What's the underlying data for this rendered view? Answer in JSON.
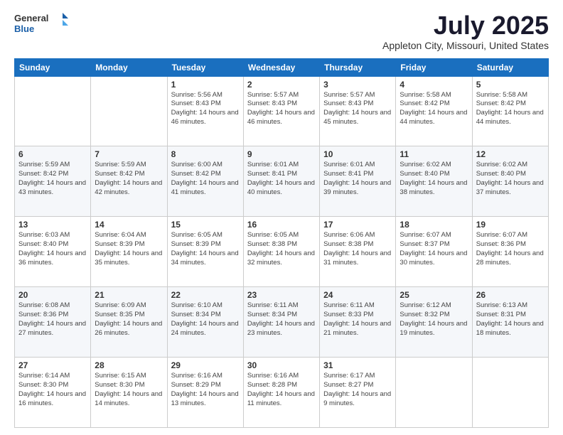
{
  "header": {
    "logo_general": "General",
    "logo_blue": "Blue",
    "month_title": "July 2025",
    "subtitle": "Appleton City, Missouri, United States"
  },
  "weekdays": [
    "Sunday",
    "Monday",
    "Tuesday",
    "Wednesday",
    "Thursday",
    "Friday",
    "Saturday"
  ],
  "weeks": [
    [
      {
        "day": "",
        "info": ""
      },
      {
        "day": "",
        "info": ""
      },
      {
        "day": "1",
        "info": "Sunrise: 5:56 AM\nSunset: 8:43 PM\nDaylight: 14 hours and 46 minutes."
      },
      {
        "day": "2",
        "info": "Sunrise: 5:57 AM\nSunset: 8:43 PM\nDaylight: 14 hours and 46 minutes."
      },
      {
        "day": "3",
        "info": "Sunrise: 5:57 AM\nSunset: 8:43 PM\nDaylight: 14 hours and 45 minutes."
      },
      {
        "day": "4",
        "info": "Sunrise: 5:58 AM\nSunset: 8:42 PM\nDaylight: 14 hours and 44 minutes."
      },
      {
        "day": "5",
        "info": "Sunrise: 5:58 AM\nSunset: 8:42 PM\nDaylight: 14 hours and 44 minutes."
      }
    ],
    [
      {
        "day": "6",
        "info": "Sunrise: 5:59 AM\nSunset: 8:42 PM\nDaylight: 14 hours and 43 minutes."
      },
      {
        "day": "7",
        "info": "Sunrise: 5:59 AM\nSunset: 8:42 PM\nDaylight: 14 hours and 42 minutes."
      },
      {
        "day": "8",
        "info": "Sunrise: 6:00 AM\nSunset: 8:42 PM\nDaylight: 14 hours and 41 minutes."
      },
      {
        "day": "9",
        "info": "Sunrise: 6:01 AM\nSunset: 8:41 PM\nDaylight: 14 hours and 40 minutes."
      },
      {
        "day": "10",
        "info": "Sunrise: 6:01 AM\nSunset: 8:41 PM\nDaylight: 14 hours and 39 minutes."
      },
      {
        "day": "11",
        "info": "Sunrise: 6:02 AM\nSunset: 8:40 PM\nDaylight: 14 hours and 38 minutes."
      },
      {
        "day": "12",
        "info": "Sunrise: 6:02 AM\nSunset: 8:40 PM\nDaylight: 14 hours and 37 minutes."
      }
    ],
    [
      {
        "day": "13",
        "info": "Sunrise: 6:03 AM\nSunset: 8:40 PM\nDaylight: 14 hours and 36 minutes."
      },
      {
        "day": "14",
        "info": "Sunrise: 6:04 AM\nSunset: 8:39 PM\nDaylight: 14 hours and 35 minutes."
      },
      {
        "day": "15",
        "info": "Sunrise: 6:05 AM\nSunset: 8:39 PM\nDaylight: 14 hours and 34 minutes."
      },
      {
        "day": "16",
        "info": "Sunrise: 6:05 AM\nSunset: 8:38 PM\nDaylight: 14 hours and 32 minutes."
      },
      {
        "day": "17",
        "info": "Sunrise: 6:06 AM\nSunset: 8:38 PM\nDaylight: 14 hours and 31 minutes."
      },
      {
        "day": "18",
        "info": "Sunrise: 6:07 AM\nSunset: 8:37 PM\nDaylight: 14 hours and 30 minutes."
      },
      {
        "day": "19",
        "info": "Sunrise: 6:07 AM\nSunset: 8:36 PM\nDaylight: 14 hours and 28 minutes."
      }
    ],
    [
      {
        "day": "20",
        "info": "Sunrise: 6:08 AM\nSunset: 8:36 PM\nDaylight: 14 hours and 27 minutes."
      },
      {
        "day": "21",
        "info": "Sunrise: 6:09 AM\nSunset: 8:35 PM\nDaylight: 14 hours and 26 minutes."
      },
      {
        "day": "22",
        "info": "Sunrise: 6:10 AM\nSunset: 8:34 PM\nDaylight: 14 hours and 24 minutes."
      },
      {
        "day": "23",
        "info": "Sunrise: 6:11 AM\nSunset: 8:34 PM\nDaylight: 14 hours and 23 minutes."
      },
      {
        "day": "24",
        "info": "Sunrise: 6:11 AM\nSunset: 8:33 PM\nDaylight: 14 hours and 21 minutes."
      },
      {
        "day": "25",
        "info": "Sunrise: 6:12 AM\nSunset: 8:32 PM\nDaylight: 14 hours and 19 minutes."
      },
      {
        "day": "26",
        "info": "Sunrise: 6:13 AM\nSunset: 8:31 PM\nDaylight: 14 hours and 18 minutes."
      }
    ],
    [
      {
        "day": "27",
        "info": "Sunrise: 6:14 AM\nSunset: 8:30 PM\nDaylight: 14 hours and 16 minutes."
      },
      {
        "day": "28",
        "info": "Sunrise: 6:15 AM\nSunset: 8:30 PM\nDaylight: 14 hours and 14 minutes."
      },
      {
        "day": "29",
        "info": "Sunrise: 6:16 AM\nSunset: 8:29 PM\nDaylight: 14 hours and 13 minutes."
      },
      {
        "day": "30",
        "info": "Sunrise: 6:16 AM\nSunset: 8:28 PM\nDaylight: 14 hours and 11 minutes."
      },
      {
        "day": "31",
        "info": "Sunrise: 6:17 AM\nSunset: 8:27 PM\nDaylight: 14 hours and 9 minutes."
      },
      {
        "day": "",
        "info": ""
      },
      {
        "day": "",
        "info": ""
      }
    ]
  ]
}
